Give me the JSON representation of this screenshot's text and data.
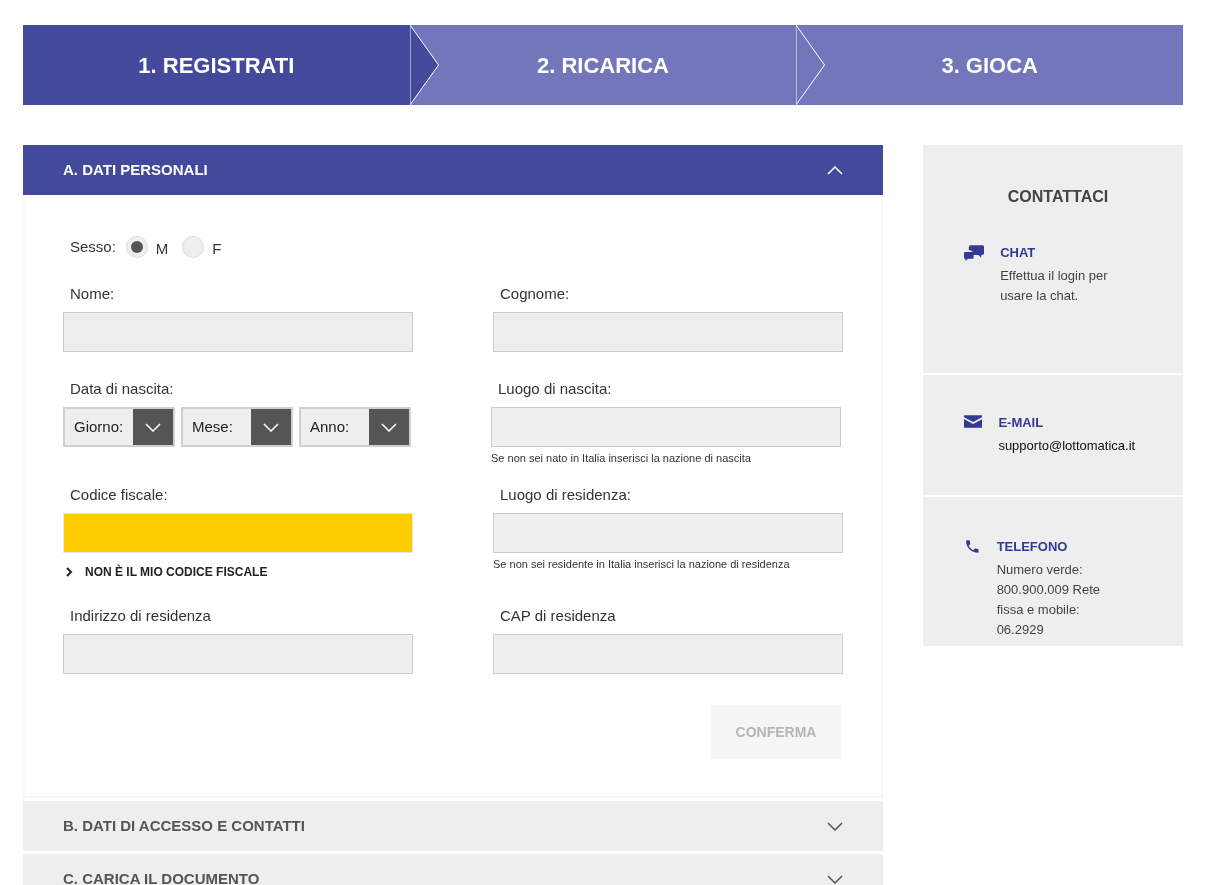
{
  "steps": [
    {
      "label": "1. REGISTRATI",
      "selected": true
    },
    {
      "label": "2. RICARICA",
      "selected": false
    },
    {
      "label": "3. GIOCA",
      "selected": false
    }
  ],
  "sections": [
    {
      "title": "A. DATI PERSONALI",
      "expanded": true
    },
    {
      "title": "B. DATI DI ACCESSO E CONTATTI",
      "expanded": false
    },
    {
      "title": "C. CARICA IL DOCUMENTO",
      "expanded": false
    }
  ],
  "form": {
    "sex": {
      "label": "Sesso:",
      "options": [
        {
          "label": "M",
          "selected": true
        },
        {
          "label": "F",
          "selected": false
        }
      ]
    },
    "rows": [
      [
        {
          "kind": "text",
          "label": "Nome:",
          "highlighted": false
        },
        {
          "kind": "text",
          "label": "Cognome:",
          "highlighted": false
        }
      ],
      [
        {
          "kind": "date",
          "label": "Data di nascita:",
          "selects": [
            "Giorno:",
            "Mese:",
            "Anno:"
          ]
        },
        {
          "kind": "text",
          "label": "Luogo di nascita:",
          "highlighted": false,
          "hint": "Se non sei nato in Italia inserisci la nazione di nascita"
        }
      ],
      [
        {
          "kind": "text",
          "label": "Codice fiscale:",
          "highlighted": true,
          "link": "NON È IL MIO CODICE FISCALE"
        },
        {
          "kind": "text",
          "label": "Luogo di residenza:",
          "highlighted": false,
          "hint": "Se non sei residente in Italia inserisci la nazione di residenza"
        }
      ],
      [
        {
          "kind": "text",
          "label": "Indirizzo di residenza",
          "highlighted": false
        },
        {
          "kind": "text",
          "label": "CAP di residenza",
          "highlighted": false
        }
      ]
    ],
    "submit": {
      "label": "CONFERMA",
      "disabled": true
    }
  },
  "contacts": {
    "title": "CONTATTACI",
    "items": [
      {
        "kind": "chat",
        "title": "CHAT",
        "text": "Effettua il login per usare la chat."
      },
      {
        "kind": "email",
        "title": "E-MAIL",
        "text": "supporto@lottomatica.it"
      },
      {
        "kind": "phone",
        "title": "TELEFONO",
        "text": "Numero verde: 800.900.009 Rete fissa e mobile: 06.2929"
      }
    ]
  }
}
